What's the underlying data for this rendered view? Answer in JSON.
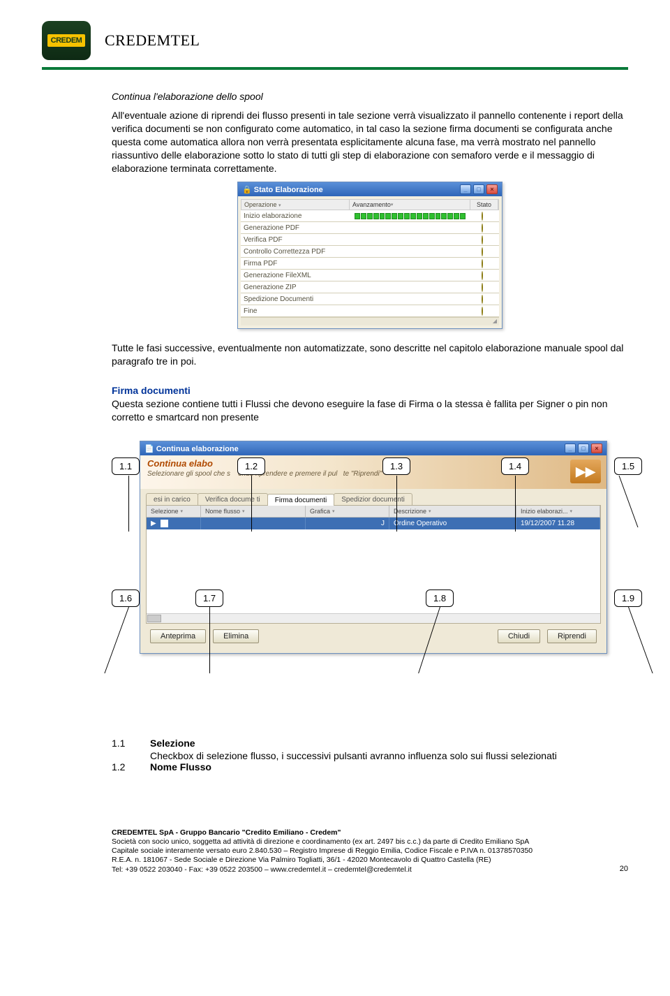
{
  "brand": "CREDEMTEL",
  "logo_text": "CREDEM",
  "section1": {
    "title": "Continua l'elaborazione dello spool",
    "para": "All'eventuale azione di riprendi dei flusso presenti in tale sezione verrà visualizzato il pannello contenente i report della verifica documenti se non configurato come automatico, in tal caso la sezione firma documenti se configurata anche questa come automatica allora non verrà presentata esplicitamente alcuna fase, ma verrà mostrato nel pannello riassuntivo delle elaborazione sotto lo stato di tutti gli step di elaborazione con semaforo verde e il messaggio di elaborazione terminata correttamente."
  },
  "stato_window": {
    "title": "Stato Elaborazione",
    "col_op": "Operazione",
    "col_av": "Avanzamento",
    "col_st": "Stato",
    "rows": [
      "Inizio elaborazione",
      "Generazione PDF",
      "Verifica PDF",
      "Controllo Correttezza PDF",
      "Firma PDF",
      "Generazione FileXML",
      "Generazione ZIP",
      "Spedizione Documenti",
      "Fine"
    ]
  },
  "mid_para": "Tutte le fasi successive, eventualmente non automatizzate, sono descritte nel capitolo elaborazione manuale spool dal paragrafo tre in poi.",
  "section2": {
    "heading": "Firma documenti",
    "para": "Questa sezione contiene tutti i Flussi che devono eseguire la fase di Firma o la stessa è fallita per Signer o pin non corretto e smartcard non presente"
  },
  "continua_window": {
    "title": "Continua elaborazione",
    "banner_title": "Continua elabo",
    "banner_sub_a": "Selezionare gli spool che s",
    "banner_sub_b": "ende riprendere e premere il pul",
    "banner_sub_c": "te \"Riprendi\"",
    "tabs": [
      "esi in carico",
      "Verifica docume  ti",
      "Firma documenti",
      "Spedizior   documenti"
    ],
    "cols": {
      "sel": "Selezione",
      "nome": "Nome flusso",
      "graf": "Grafica",
      "desc": "Descrizione",
      "iniz": "Inizio elaborazi..."
    },
    "row": {
      "nome": "J",
      "desc": "Ordine Operativo",
      "iniz": "19/12/2007 11.28"
    },
    "buttons": {
      "anteprima": "Anteprima",
      "elimina": "Elimina",
      "chiudi": "Chiudi",
      "riprendi": "Riprendi"
    }
  },
  "callouts": {
    "c11": "1.1",
    "c12": "1.2",
    "c13": "1.3",
    "c14": "1.4",
    "c15": "1.5",
    "c16": "1.6",
    "c17": "1.7",
    "c18": "1.8",
    "c19": "1.9"
  },
  "defs": {
    "n11": "1.1",
    "t11": "Selezione",
    "d11": "Checkbox di selezione flusso, i successivi pulsanti avranno influenza solo sui flussi selezionati",
    "n12": "1.2",
    "t12": "Nome Flusso"
  },
  "footer": {
    "l1": "CREDEMTEL SpA - Gruppo Bancario \"Credito Emiliano - Credem\"",
    "l2": "Società con socio unico, soggetta ad attività di direzione e coordinamento (ex art. 2497 bis c.c.) da parte di Credito Emiliano SpA",
    "l3": "Capitale sociale interamente versato euro 2.840.530 – Registro Imprese di Reggio Emilia, Codice Fiscale e P.IVA n. 01378570350",
    "l4": "R.E.A. n. 181067 - Sede Sociale e Direzione Via Palmiro Togliatti, 36/1 - 42020 Montecavolo di Quattro Castella (RE)",
    "l5": "Tel: +39 0522 203040 - Fax: +39 0522 203500 – www.credemtel.it – credemtel@credemtel.it",
    "page": "20"
  }
}
